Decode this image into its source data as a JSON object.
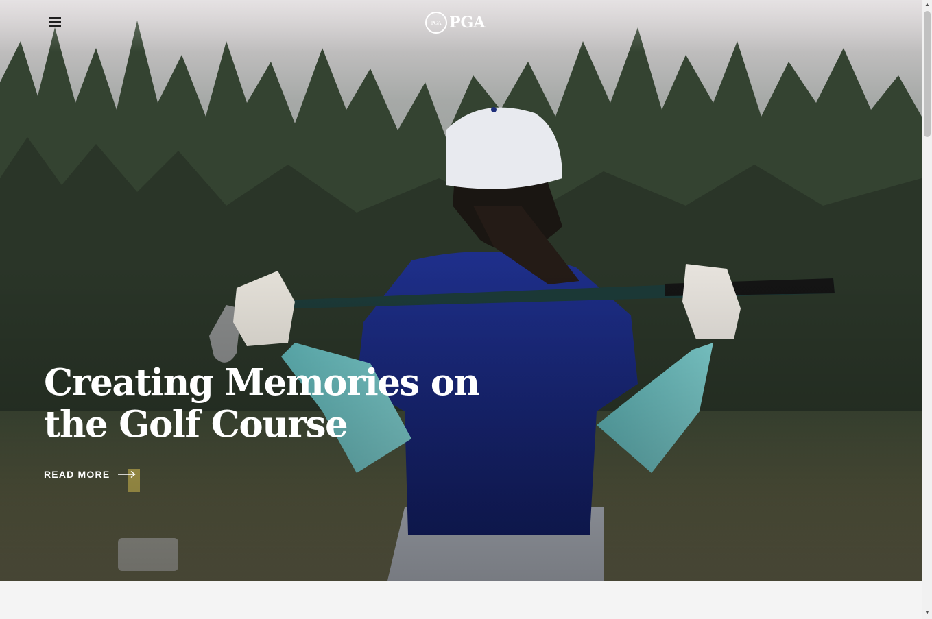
{
  "header": {
    "menu_icon": "hamburger-menu-icon",
    "logo": {
      "seal_text": "PGA",
      "wordmark": "PGA"
    }
  },
  "hero": {
    "headline": "Creating Memories on the Golf Course",
    "cta_label": "READ MORE",
    "cta_icon": "long-arrow-right-icon"
  },
  "colors": {
    "text_on_image": "#ffffff",
    "menu_icon": "#1f1f1f",
    "page_background": "#f4f4f4",
    "scrollbar_thumb": "#c1c1c1"
  }
}
